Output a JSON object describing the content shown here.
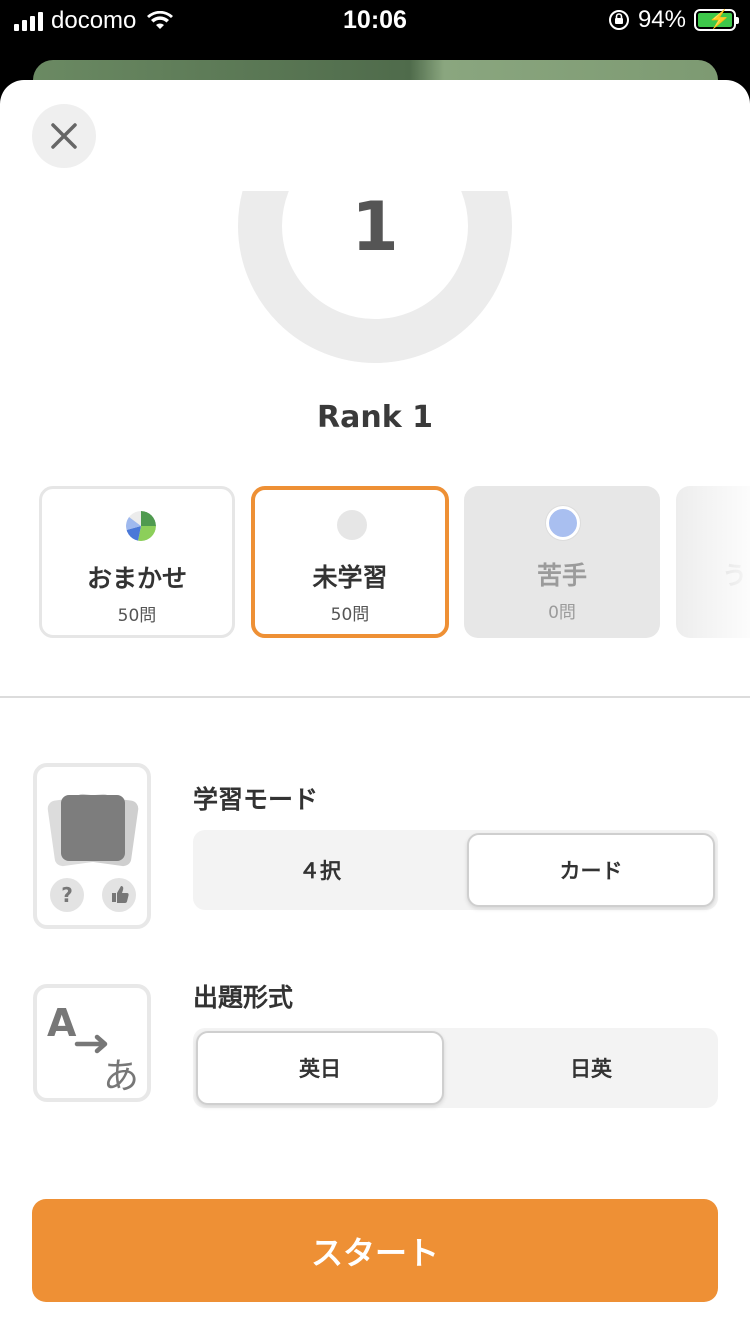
{
  "status_bar": {
    "carrier": "docomo",
    "time": "10:06",
    "battery": "94%",
    "battery_level": 0.94
  },
  "rank": {
    "number": "1",
    "label": "Rank 1"
  },
  "categories": [
    {
      "name": "おまかせ",
      "count": "50問",
      "state": "normal"
    },
    {
      "name": "未学習",
      "count": "50問",
      "state": "selected"
    },
    {
      "name": "苦手",
      "count": "0問",
      "state": "disabled"
    },
    {
      "name": "う",
      "count": "",
      "state": "partial"
    }
  ],
  "study_mode": {
    "title": "学習モード",
    "options": [
      "４択",
      "カード"
    ],
    "selected": "カード"
  },
  "question_format": {
    "title": "出題形式",
    "options": [
      "英日",
      "日英"
    ],
    "selected": "英日",
    "icon_letters": {
      "from": "A",
      "to": "あ"
    }
  },
  "start_button": "スタート",
  "colors": {
    "accent": "#ee9035",
    "weak_dot": "#a9bff0",
    "unlearned_dot": "#e6e6e6"
  }
}
